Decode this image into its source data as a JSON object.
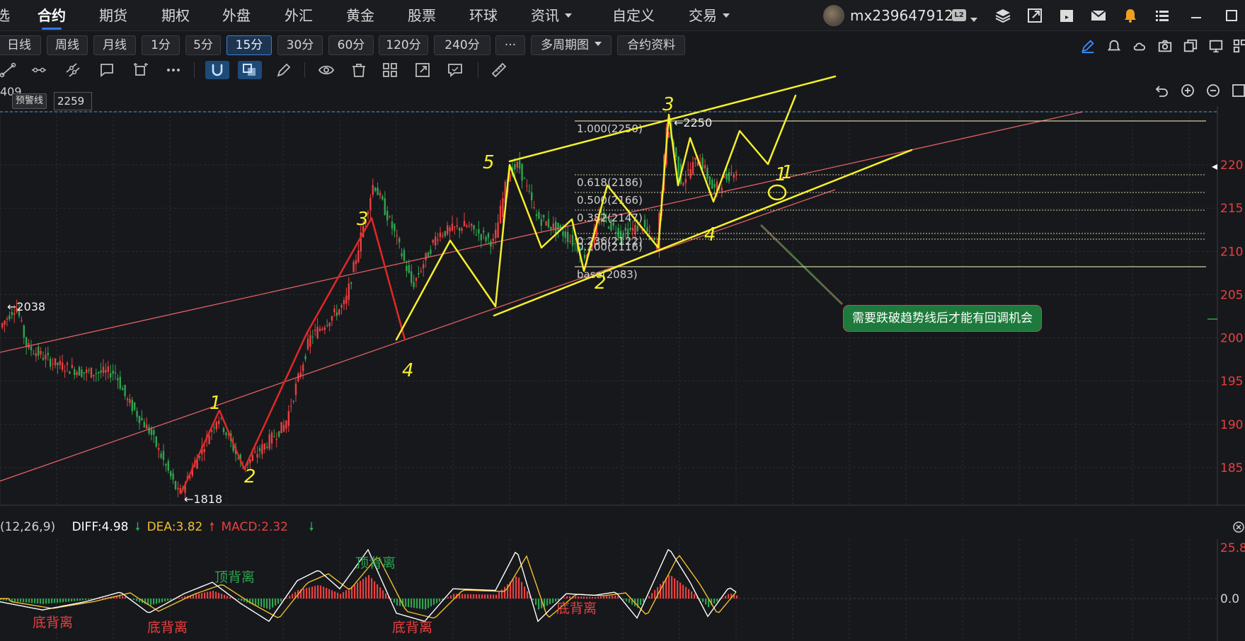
{
  "top_nav": {
    "first_item_fragment": "选",
    "items": [
      {
        "label": "合约",
        "active": true
      },
      {
        "label": "期货"
      },
      {
        "label": "期权"
      },
      {
        "label": "外盘"
      },
      {
        "label": "外汇"
      },
      {
        "label": "黄金"
      },
      {
        "label": "股票"
      },
      {
        "label": "环球"
      },
      {
        "label": "资讯",
        "dropdown": true
      },
      {
        "label": "自定义"
      },
      {
        "label": "交易",
        "dropdown": true
      }
    ],
    "user": {
      "name": "mx239647912",
      "badge": "L2"
    },
    "icons": [
      "layers-icon",
      "external-link-icon",
      "clapper-icon",
      "mail-icon",
      "bell-icon",
      "menu-list-icon",
      "minimize-icon"
    ]
  },
  "period_toolbar": {
    "buttons": [
      {
        "label": "日线"
      },
      {
        "label": "周线"
      },
      {
        "label": "月线"
      },
      {
        "label": "1分"
      },
      {
        "label": "5分"
      },
      {
        "label": "15分",
        "active": true
      },
      {
        "label": "30分"
      },
      {
        "label": "60分"
      },
      {
        "label": "120分"
      },
      {
        "label": "240分"
      },
      {
        "label": "···"
      },
      {
        "label": "多周期图",
        "dropdown": true
      },
      {
        "label": "合约资料"
      }
    ],
    "right_icons": [
      "pen-icon",
      "alarm-icon",
      "cloud-icon",
      "camera-icon",
      "copy-window-icon",
      "monitor-icon",
      "grid-icon"
    ]
  },
  "draw_toolbar": {
    "icons": [
      "segment-icon",
      "ray-icon",
      "channel-icon",
      "comment-icon",
      "transform-icon",
      "more-icon",
      "magnet-icon",
      "overlap-icon",
      "pencil-icon",
      "eye-icon",
      "trash-icon",
      "layout-icon",
      "export-icon",
      "message-icon",
      "ruler-icon"
    ]
  },
  "chart": {
    "top_left_price": "409",
    "alert": {
      "label": "预警线",
      "value": "2259"
    },
    "zoom_icons": [
      "undo-icon",
      "zoom-in-icon",
      "zoom-out-icon",
      "expand-icon"
    ],
    "y_axis_ticks": [
      "220",
      "215",
      "210",
      "205",
      "200",
      "195",
      "190",
      "185"
    ],
    "price_markers": [
      {
        "text": "←2038"
      },
      {
        "text": "←1818"
      },
      {
        "text": "←2250"
      }
    ],
    "fib_levels": [
      {
        "text": "1.000(2250)"
      },
      {
        "text": "0.618(2186)"
      },
      {
        "text": "0.500(2166)"
      },
      {
        "text": "0.382(2147)"
      },
      {
        "text": "0.236(2122)"
      },
      {
        "text": "0.200(2116)"
      },
      {
        "text": "base(2083)"
      }
    ],
    "wave_labels": [
      "1",
      "2",
      "3",
      "4",
      "5",
      "1",
      "2",
      "3",
      "4",
      "1"
    ],
    "annotation": "需要跌破趋势线后才能有回调机会",
    "colors": {
      "up": "#e84040",
      "down": "#2ea44f",
      "trend": "#f5f02a",
      "channel": "#e06060",
      "fib": "#cfcfa0",
      "annotation_bg": "#1e7a3c"
    }
  },
  "macd": {
    "params": "(12,26,9)",
    "diff": "DIFF:4.98",
    "dea": "DEA:3.82",
    "macd": "MACD:2.32",
    "y_ticks": [
      "25.8",
      "0.0"
    ],
    "divergence_labels": [
      {
        "text": "顶背离",
        "type": "top"
      },
      {
        "text": "顶背离",
        "type": "top"
      },
      {
        "text": "底背离",
        "type": "bottom"
      },
      {
        "text": "底背离",
        "type": "bottom"
      },
      {
        "text": "底背离",
        "type": "bottom"
      },
      {
        "text": "底背离",
        "type": "bottom"
      }
    ],
    "colors": {
      "diff": "#ffffff",
      "dea": "#f0c030",
      "macd": "#e84040",
      "hist_up": "#e84040",
      "hist_down": "#2ea44f"
    }
  }
}
